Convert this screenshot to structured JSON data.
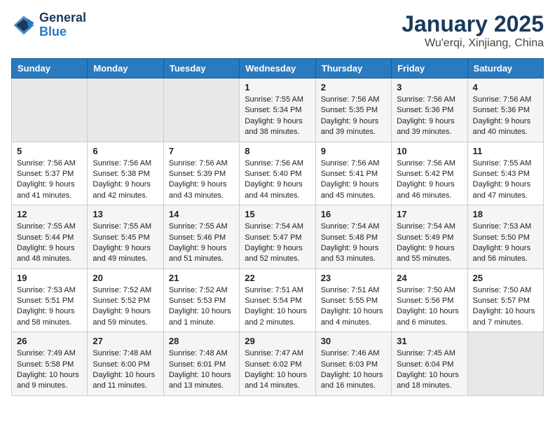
{
  "header": {
    "logo_line1": "General",
    "logo_line2": "Blue",
    "month": "January 2025",
    "location": "Wu'erqi, Xinjiang, China"
  },
  "weekdays": [
    "Sunday",
    "Monday",
    "Tuesday",
    "Wednesday",
    "Thursday",
    "Friday",
    "Saturday"
  ],
  "weeks": [
    [
      {
        "day": "",
        "info": ""
      },
      {
        "day": "",
        "info": ""
      },
      {
        "day": "",
        "info": ""
      },
      {
        "day": "1",
        "info": "Sunrise: 7:55 AM\nSunset: 5:34 PM\nDaylight: 9 hours\nand 38 minutes."
      },
      {
        "day": "2",
        "info": "Sunrise: 7:56 AM\nSunset: 5:35 PM\nDaylight: 9 hours\nand 39 minutes."
      },
      {
        "day": "3",
        "info": "Sunrise: 7:56 AM\nSunset: 5:36 PM\nDaylight: 9 hours\nand 39 minutes."
      },
      {
        "day": "4",
        "info": "Sunrise: 7:56 AM\nSunset: 5:36 PM\nDaylight: 9 hours\nand 40 minutes."
      }
    ],
    [
      {
        "day": "5",
        "info": "Sunrise: 7:56 AM\nSunset: 5:37 PM\nDaylight: 9 hours\nand 41 minutes."
      },
      {
        "day": "6",
        "info": "Sunrise: 7:56 AM\nSunset: 5:38 PM\nDaylight: 9 hours\nand 42 minutes."
      },
      {
        "day": "7",
        "info": "Sunrise: 7:56 AM\nSunset: 5:39 PM\nDaylight: 9 hours\nand 43 minutes."
      },
      {
        "day": "8",
        "info": "Sunrise: 7:56 AM\nSunset: 5:40 PM\nDaylight: 9 hours\nand 44 minutes."
      },
      {
        "day": "9",
        "info": "Sunrise: 7:56 AM\nSunset: 5:41 PM\nDaylight: 9 hours\nand 45 minutes."
      },
      {
        "day": "10",
        "info": "Sunrise: 7:56 AM\nSunset: 5:42 PM\nDaylight: 9 hours\nand 46 minutes."
      },
      {
        "day": "11",
        "info": "Sunrise: 7:55 AM\nSunset: 5:43 PM\nDaylight: 9 hours\nand 47 minutes."
      }
    ],
    [
      {
        "day": "12",
        "info": "Sunrise: 7:55 AM\nSunset: 5:44 PM\nDaylight: 9 hours\nand 48 minutes."
      },
      {
        "day": "13",
        "info": "Sunrise: 7:55 AM\nSunset: 5:45 PM\nDaylight: 9 hours\nand 49 minutes."
      },
      {
        "day": "14",
        "info": "Sunrise: 7:55 AM\nSunset: 5:46 PM\nDaylight: 9 hours\nand 51 minutes."
      },
      {
        "day": "15",
        "info": "Sunrise: 7:54 AM\nSunset: 5:47 PM\nDaylight: 9 hours\nand 52 minutes."
      },
      {
        "day": "16",
        "info": "Sunrise: 7:54 AM\nSunset: 5:48 PM\nDaylight: 9 hours\nand 53 minutes."
      },
      {
        "day": "17",
        "info": "Sunrise: 7:54 AM\nSunset: 5:49 PM\nDaylight: 9 hours\nand 55 minutes."
      },
      {
        "day": "18",
        "info": "Sunrise: 7:53 AM\nSunset: 5:50 PM\nDaylight: 9 hours\nand 56 minutes."
      }
    ],
    [
      {
        "day": "19",
        "info": "Sunrise: 7:53 AM\nSunset: 5:51 PM\nDaylight: 9 hours\nand 58 minutes."
      },
      {
        "day": "20",
        "info": "Sunrise: 7:52 AM\nSunset: 5:52 PM\nDaylight: 9 hours\nand 59 minutes."
      },
      {
        "day": "21",
        "info": "Sunrise: 7:52 AM\nSunset: 5:53 PM\nDaylight: 10 hours\nand 1 minute."
      },
      {
        "day": "22",
        "info": "Sunrise: 7:51 AM\nSunset: 5:54 PM\nDaylight: 10 hours\nand 2 minutes."
      },
      {
        "day": "23",
        "info": "Sunrise: 7:51 AM\nSunset: 5:55 PM\nDaylight: 10 hours\nand 4 minutes."
      },
      {
        "day": "24",
        "info": "Sunrise: 7:50 AM\nSunset: 5:56 PM\nDaylight: 10 hours\nand 6 minutes."
      },
      {
        "day": "25",
        "info": "Sunrise: 7:50 AM\nSunset: 5:57 PM\nDaylight: 10 hours\nand 7 minutes."
      }
    ],
    [
      {
        "day": "26",
        "info": "Sunrise: 7:49 AM\nSunset: 5:58 PM\nDaylight: 10 hours\nand 9 minutes."
      },
      {
        "day": "27",
        "info": "Sunrise: 7:48 AM\nSunset: 6:00 PM\nDaylight: 10 hours\nand 11 minutes."
      },
      {
        "day": "28",
        "info": "Sunrise: 7:48 AM\nSunset: 6:01 PM\nDaylight: 10 hours\nand 13 minutes."
      },
      {
        "day": "29",
        "info": "Sunrise: 7:47 AM\nSunset: 6:02 PM\nDaylight: 10 hours\nand 14 minutes."
      },
      {
        "day": "30",
        "info": "Sunrise: 7:46 AM\nSunset: 6:03 PM\nDaylight: 10 hours\nand 16 minutes."
      },
      {
        "day": "31",
        "info": "Sunrise: 7:45 AM\nSunset: 6:04 PM\nDaylight: 10 hours\nand 18 minutes."
      },
      {
        "day": "",
        "info": ""
      }
    ]
  ]
}
